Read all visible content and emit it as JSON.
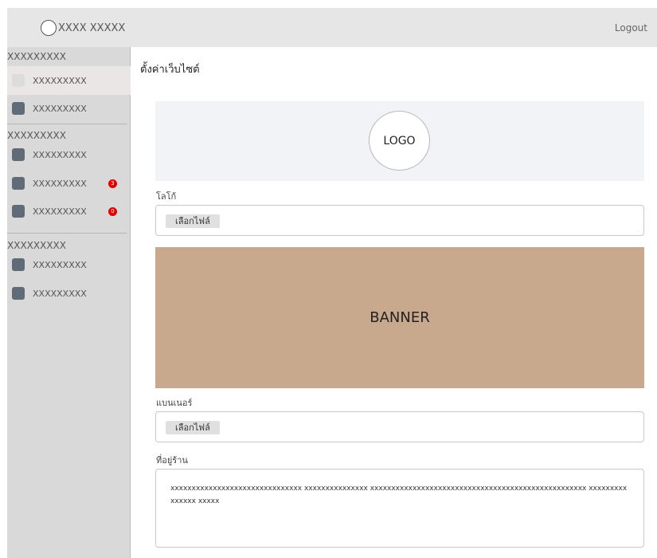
{
  "header": {
    "brand": "XXXX XXXXX",
    "logout": "Logout"
  },
  "sidebar": {
    "groups": [
      {
        "title": "XXXXXXXXX",
        "items": [
          {
            "label": "XXXXXXXXX"
          },
          {
            "label": "XXXXXXXXX"
          }
        ]
      },
      {
        "title": "XXXXXXXXX",
        "items": [
          {
            "label": "XXXXXXXXX"
          },
          {
            "label": "XXXXXXXXX",
            "badge": "3"
          },
          {
            "label": "XXXXXXXXX",
            "badge": "0"
          }
        ]
      },
      {
        "title": "XXXXXXXXX",
        "items": [
          {
            "label": "XXXXXXXXX"
          },
          {
            "label": "XXXXXXXXX"
          }
        ]
      }
    ]
  },
  "main": {
    "title": "ตั้งค่าเว็บไซต์",
    "logo_placeholder": "LOGO",
    "logo_label": "โลโก้",
    "file_button": "เลือกไฟล์",
    "banner_placeholder": "BANNER",
    "banner_label": "แบนเนอร์",
    "address_label": "ที่อยู่ร้าน",
    "address_value": "xxxxxxxxxxxxxxxxxxxxxxxxxxxxxxx xxxxxxxxxxxxxxx xxxxxxxxxxxxxxxxxxxxxxxxxxxxxxxxxxxxxxxxxxxxxxxxxxx xxxxxxxxxxxxxxx xxxxx"
  },
  "colors": {
    "badge": "#e20000",
    "banner": "#c9a98e",
    "nav_icon": "#5f6b76"
  }
}
